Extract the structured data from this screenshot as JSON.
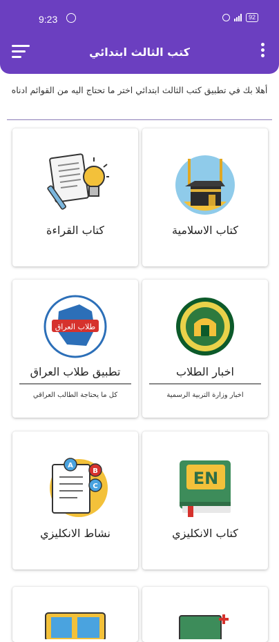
{
  "status_bar": {
    "time": "9:23",
    "battery": "92"
  },
  "header": {
    "title": "كتب الثالث ابتدائي",
    "menu_icon": "hamburger-menu-icon",
    "more_icon": "more-vert-icon"
  },
  "welcome_text": "أهلا بك في تطبيق كتب الثالث ابتدائي اختر ما تحتاج اليه من القوائم ادناه",
  "cards": [
    {
      "label": "كتاب الاسلامية",
      "icon": "kaaba-icon"
    },
    {
      "label": "كتاب القراءة",
      "icon": "reading-icon"
    },
    {
      "label": "اخبار الطلاب",
      "sub": "اخبار وزارة التربية الرسمية",
      "icon": "ministry-logo-icon"
    },
    {
      "label": "تطبيق طلاب العراق",
      "sub": "كل ما يحتاجة الطالب العراقي",
      "icon": "iraq-students-logo-icon",
      "logo_text": "طلاب العراق"
    },
    {
      "label": "كتاب الانكليزي",
      "icon": "english-book-icon",
      "book_text": "EN"
    },
    {
      "label": "نشاط الانكليزي",
      "icon": "english-activity-icon",
      "abc": [
        "A",
        "B",
        "C"
      ]
    }
  ],
  "colors": {
    "primary": "#6b3fc0",
    "accent_yellow": "#f3c13a",
    "book_green": "#3d8c5a"
  }
}
